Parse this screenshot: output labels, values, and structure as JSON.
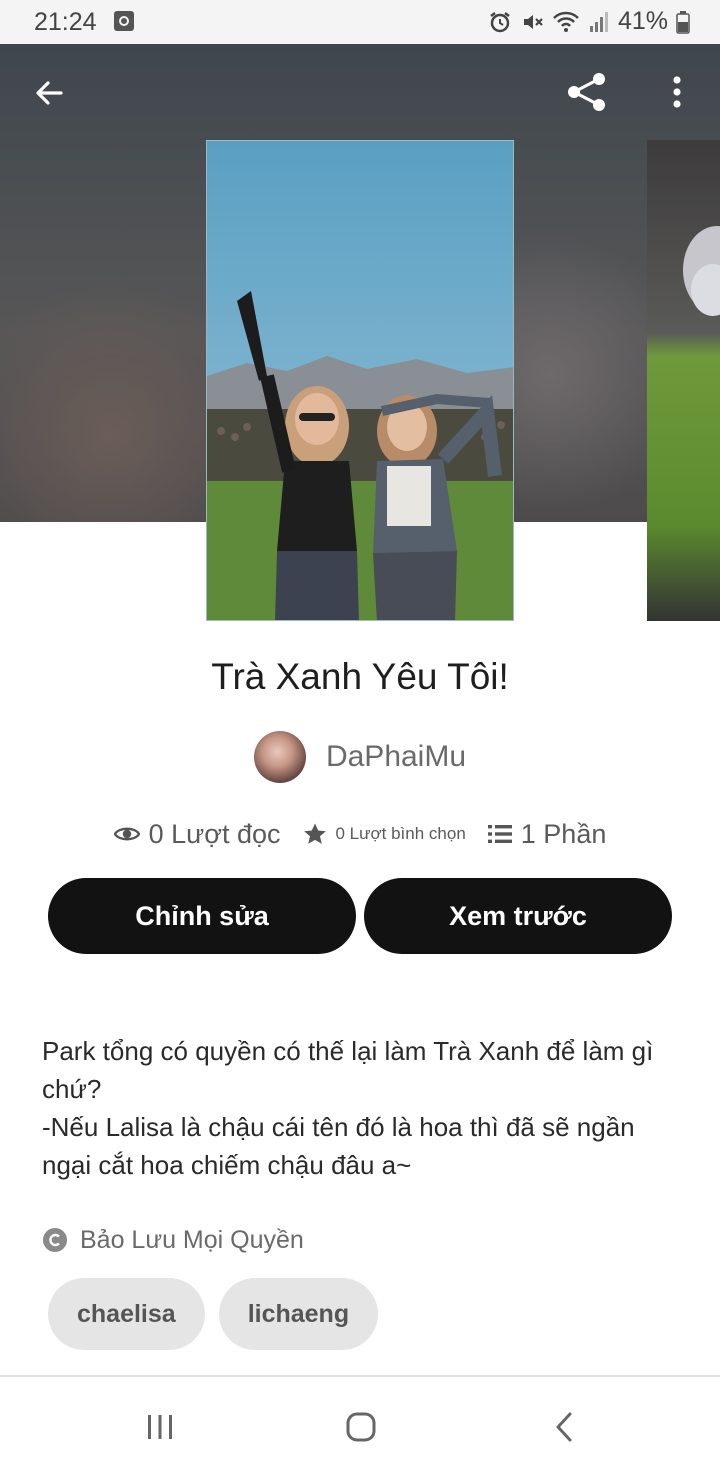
{
  "status_bar": {
    "time": "21:24",
    "battery_percent": "41%",
    "icons": [
      "alarm-icon",
      "mute-icon",
      "wifi-icon",
      "signal-icon",
      "battery-icon"
    ]
  },
  "header": {
    "back_icon": "arrow-left-icon",
    "share_icon": "share-icon",
    "more_icon": "more-vertical-icon"
  },
  "story": {
    "title": "Trà Xanh Yêu Tôi!",
    "author": "DaPhaiMu",
    "stats": {
      "reads": "0 Lượt đọc",
      "votes": "0 Lượt bình chọn",
      "parts": "1 Phần"
    },
    "actions": {
      "edit_label": "Chỉnh sửa",
      "preview_label": "Xem trước"
    },
    "description_lines": [
      "Park tổng có quyền có thế lại làm Trà Xanh để làm gì",
      "chứ?",
      "-Nếu Lalisa là chậu cái tên đó là hoa thì đã sẽ ngần",
      "ngại cắt hoa chiếm chậu đâu a~"
    ],
    "rights": "Bảo Lưu Mọi Quyền",
    "tags": [
      "chaelisa",
      "lichaeng"
    ]
  },
  "colors": {
    "button_bg": "#121212",
    "tag_bg": "#e5e5e5",
    "header_bg": "#4b4f52"
  },
  "nav_bar": {
    "recent_icon": "recent-apps-icon",
    "home_icon": "home-icon",
    "back_icon": "nav-back-icon"
  }
}
